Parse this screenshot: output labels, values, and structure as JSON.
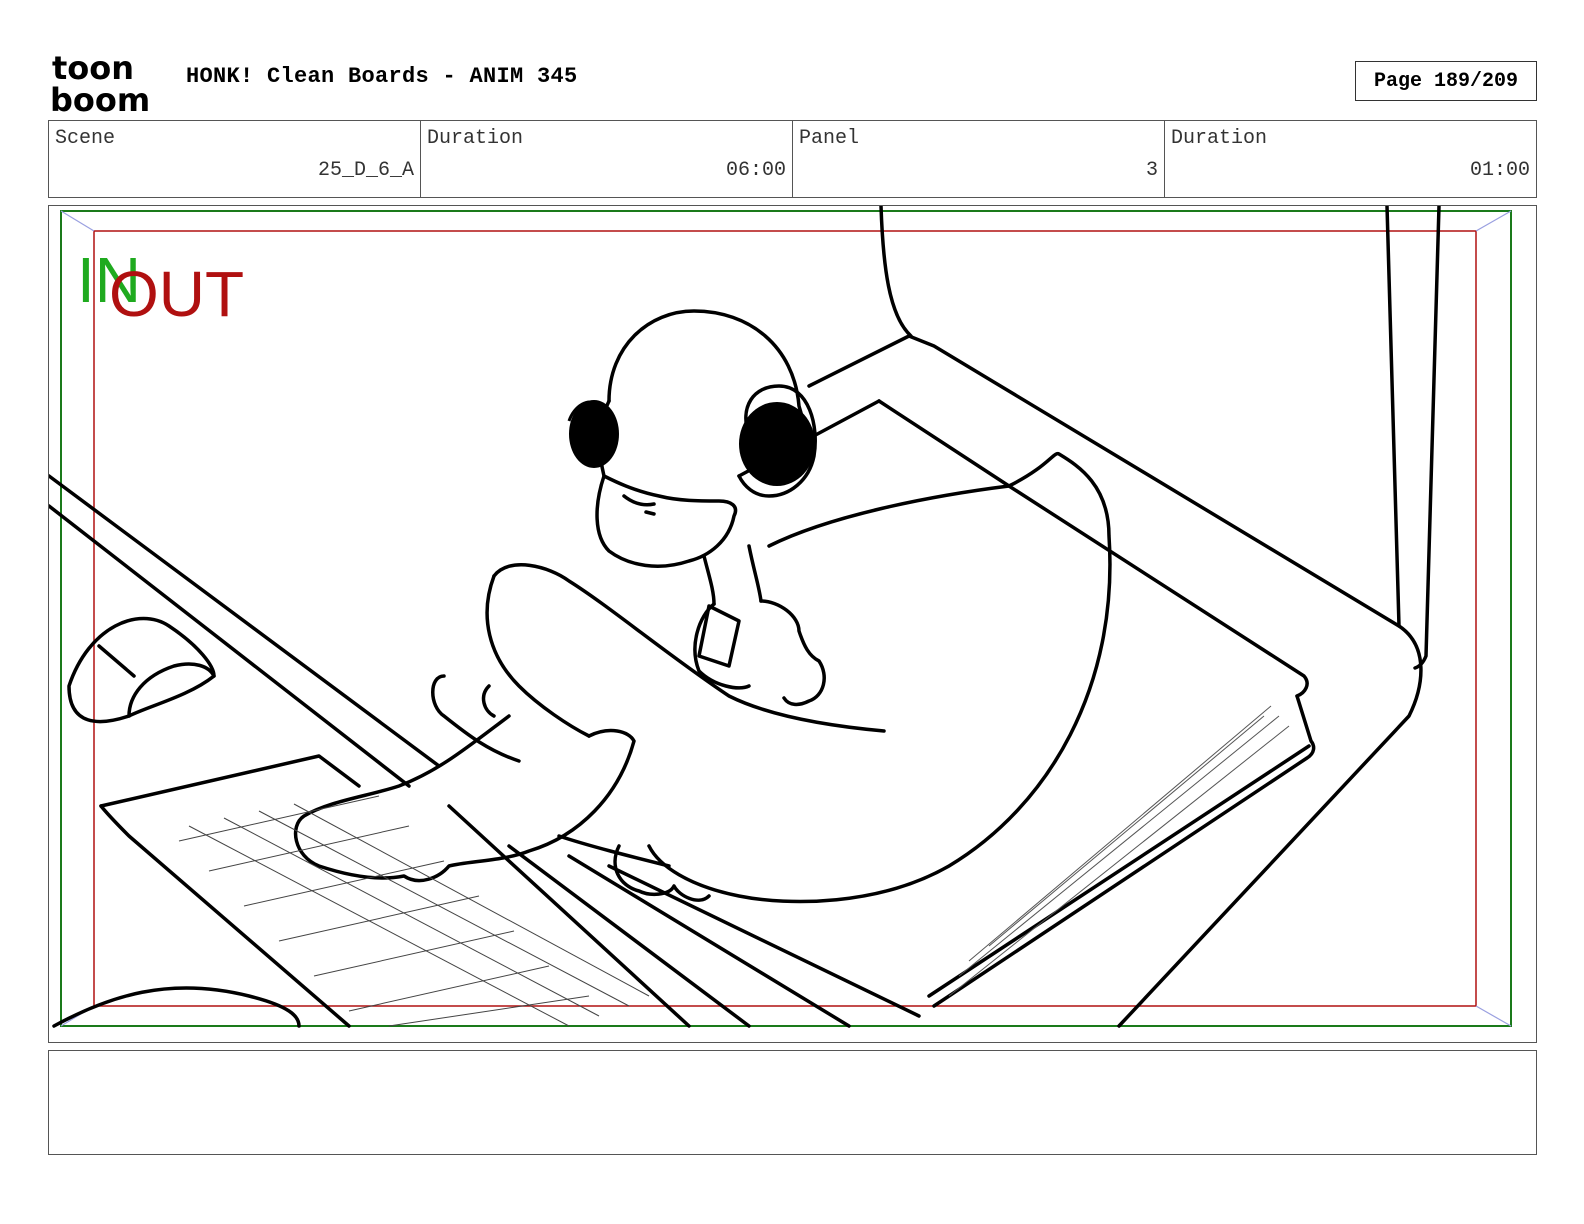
{
  "header": {
    "logo_top": "toon",
    "logo_bottom": "boom",
    "title": "HONK! Clean Boards - ANIM 345",
    "page_label": "Page 189/209"
  },
  "info": {
    "scene_label": "Scene",
    "scene_value": "25_D_6_A",
    "scene_duration_label": "Duration",
    "scene_duration_value": "06:00",
    "panel_label": "Panel",
    "panel_value": "3",
    "panel_duration_label": "Duration",
    "panel_duration_value": "01:00"
  },
  "panel": {
    "in_label": "IN",
    "out_label": "OUT",
    "in_color": "#1faa1f",
    "out_color": "#b01010"
  },
  "notes": {
    "text": ""
  }
}
